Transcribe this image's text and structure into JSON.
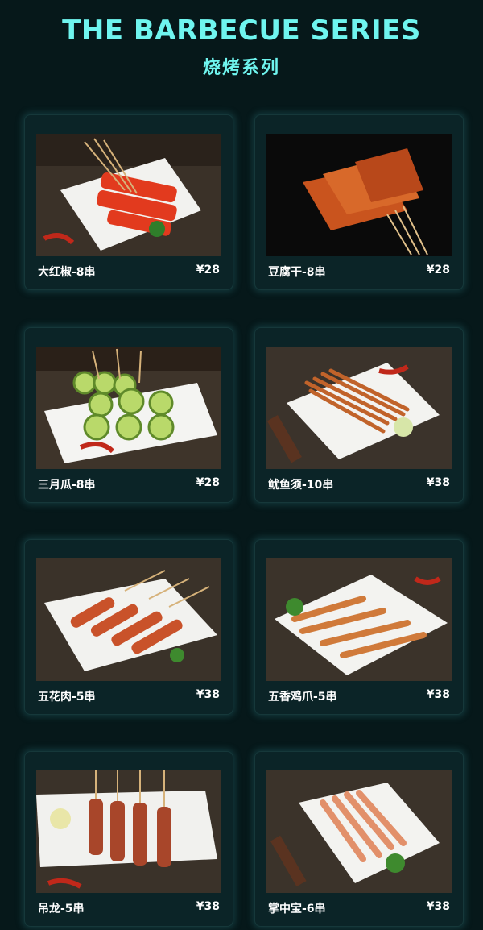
{
  "header": {
    "title": "THE BARBECUE SERIES",
    "subtitle": "烧烤系列"
  },
  "items": [
    {
      "name": "大红椒-8串",
      "price": "¥28"
    },
    {
      "name": "豆腐干-8串",
      "price": "¥28"
    },
    {
      "name": "三月瓜-8串",
      "price": "¥28"
    },
    {
      "name": "鱿鱼须-10串",
      "price": "¥38"
    },
    {
      "name": "五花肉-5串",
      "price": "¥38"
    },
    {
      "name": "五香鸡爪-5串",
      "price": "¥38"
    },
    {
      "name": "吊龙-5串",
      "price": "¥38"
    },
    {
      "name": "掌中宝-6串",
      "price": "¥38"
    }
  ],
  "colors": {
    "background": "#06181a",
    "accent": "#6ff5ef",
    "card": "#0b2427"
  }
}
